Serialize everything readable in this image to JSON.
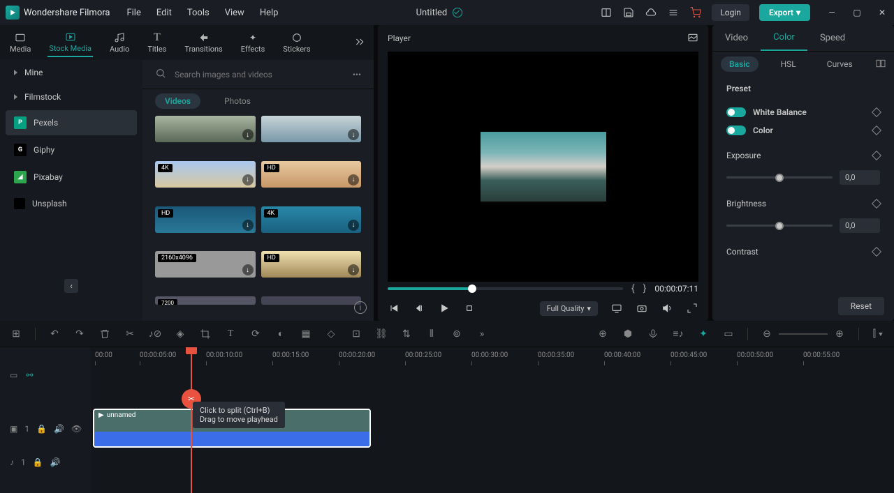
{
  "app_name": "Wondershare Filmora",
  "menu": {
    "file": "File",
    "edit": "Edit",
    "tools": "Tools",
    "view": "View",
    "help": "Help"
  },
  "project_title": "Untitled",
  "login": "Login",
  "export": "Export",
  "top_tabs": {
    "media": "Media",
    "stock": "Stock Media",
    "audio": "Audio",
    "titles": "Titles",
    "transitions": "Transitions",
    "effects": "Effects",
    "stickers": "Stickers"
  },
  "sidebar": {
    "mine": "Mine",
    "filmstock": "Filmstock",
    "pexels": "Pexels",
    "giphy": "Giphy",
    "pixabay": "Pixabay",
    "unsplash": "Unsplash"
  },
  "search": {
    "placeholder": "Search images and videos"
  },
  "filter": {
    "videos": "Videos",
    "photos": "Photos"
  },
  "thumbs": {
    "b4k": "4K",
    "bhd": "HD",
    "res": "2160x4096",
    "res2": "7200"
  },
  "player": {
    "label": "Player",
    "timecode": "00:00:07:11",
    "quality": "Full Quality"
  },
  "rp": {
    "video": "Video",
    "color": "Color",
    "speed": "Speed",
    "basic": "Basic",
    "hsl": "HSL",
    "curves": "Curves",
    "preset": "Preset",
    "wb": "White Balance",
    "col": "Color",
    "exposure": "Exposure",
    "brightness": "Brightness",
    "contrast": "Contrast",
    "val": "0,0",
    "reset": "Reset"
  },
  "ruler": [
    "00:00",
    "00:00:05:00",
    "00:00:10:00",
    "00:00:15:00",
    "00:00:20:00",
    "00:00:25:00",
    "00:00:30:00",
    "00:00:35:00",
    "00:00:40:00",
    "00:00:45:00",
    "00:00:50:00",
    "00:00:55:00"
  ],
  "clip_name": "unnamed",
  "track": {
    "v": "1",
    "a": "1"
  },
  "tooltip": {
    "l1": "Click to split (Ctrl+B)",
    "l2": "Drag to move playhead"
  }
}
